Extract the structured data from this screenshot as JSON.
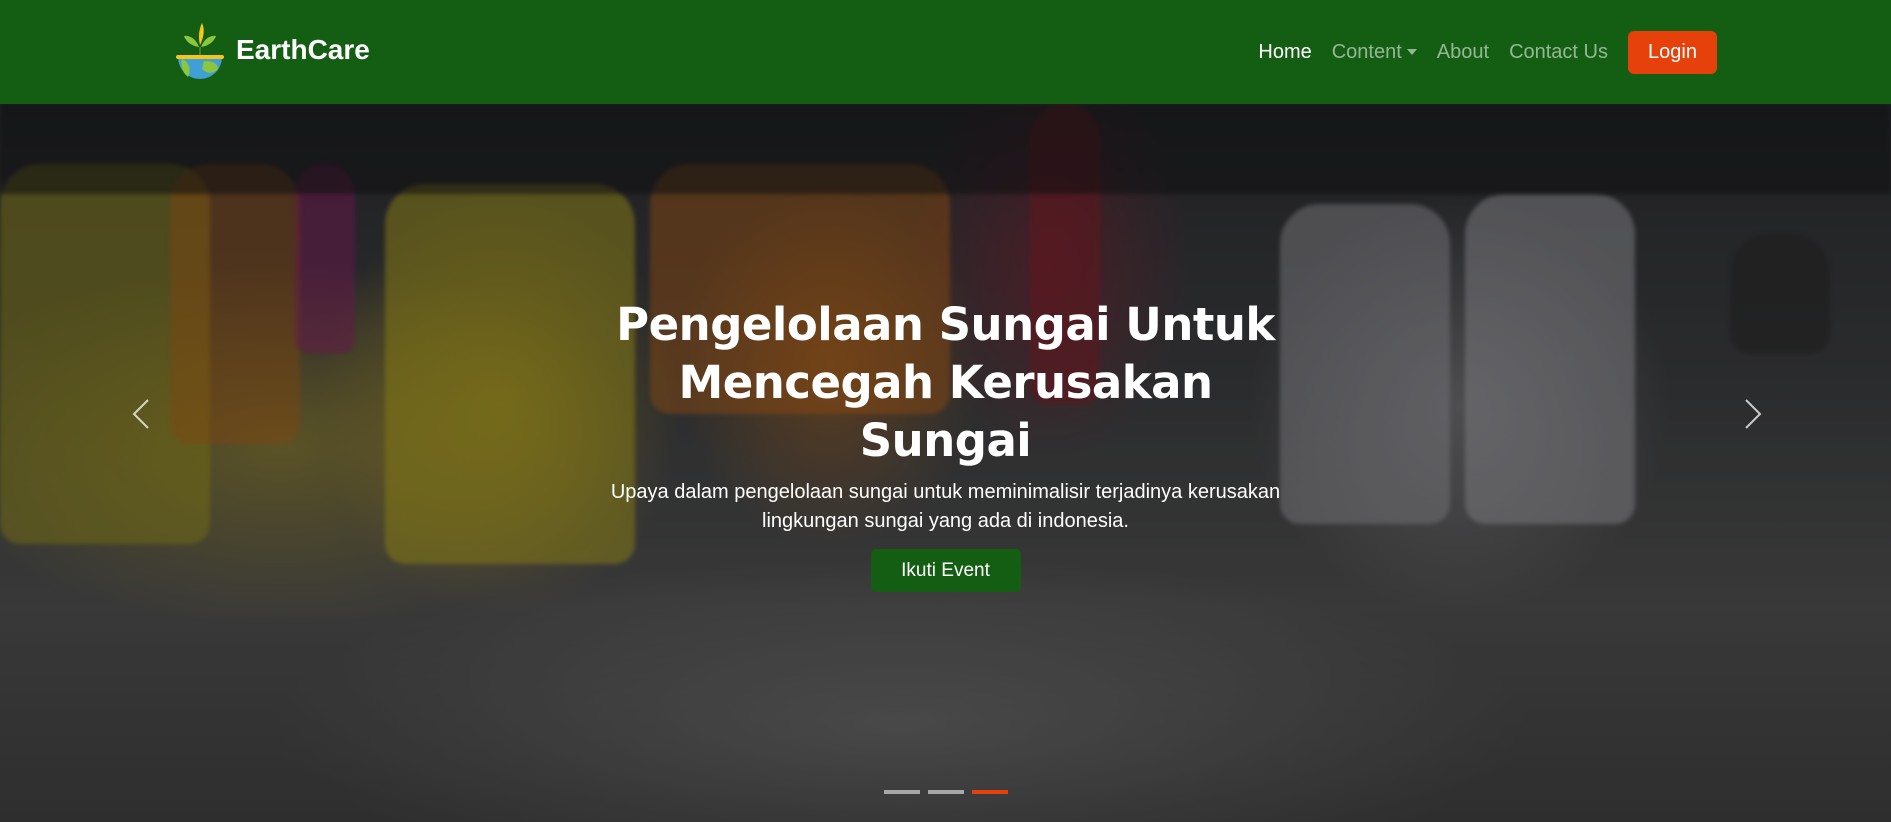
{
  "brand": {
    "name": "EarthCare"
  },
  "nav": {
    "items": [
      {
        "label": "Home",
        "active": true
      },
      {
        "label": "Content",
        "dropdown": true
      },
      {
        "label": "About"
      },
      {
        "label": "Contact Us"
      }
    ],
    "login_label": "Login"
  },
  "hero": {
    "title": "Pengelolaan Sungai Untuk Mencegah Kerusakan Sungai",
    "subtitle": "Upaya dalam pengelolaan sungai untuk meminimalisir terjadinya kerusakan lingkungan sungai yang ada di indonesia.",
    "cta_label": "Ikuti Event",
    "controls": {
      "prev_icon": "chevron-left-icon",
      "next_icon": "chevron-right-icon"
    },
    "indicators": {
      "count": 3,
      "active_index": 2
    }
  },
  "colors": {
    "navbar": "#135e13",
    "accent": "#e6410b",
    "cta": "#135e13"
  }
}
